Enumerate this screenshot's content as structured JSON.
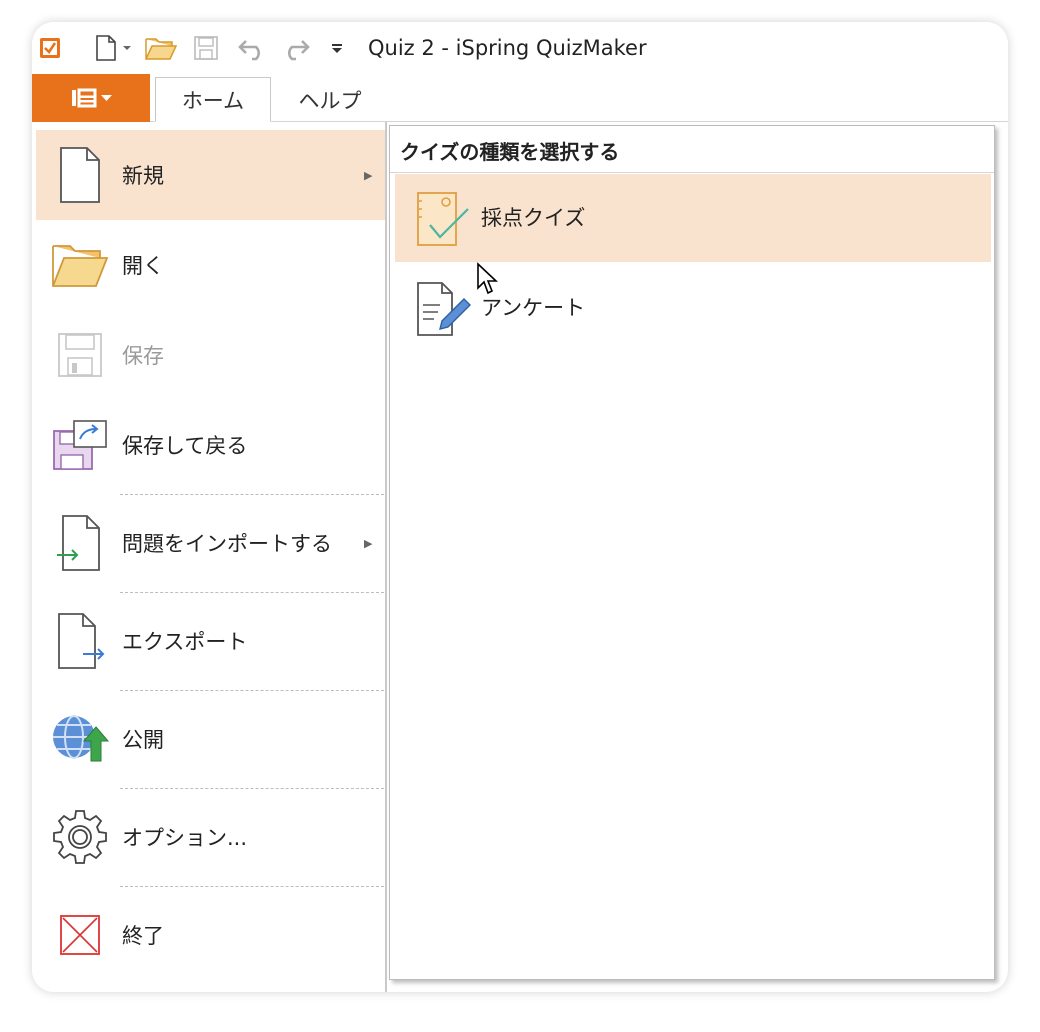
{
  "window": {
    "title": "Quiz 2 - iSpring QuizMaker"
  },
  "tabs": [
    {
      "label": "ホーム"
    },
    {
      "label": "ヘルプ"
    }
  ],
  "file_menu": {
    "items": [
      {
        "label": "新規"
      },
      {
        "label": "開く"
      },
      {
        "label": "保存"
      },
      {
        "label": "保存して戻る"
      },
      {
        "label": "問題をインポートする"
      },
      {
        "label": "エクスポート"
      },
      {
        "label": "公開"
      },
      {
        "label": "オプション..."
      },
      {
        "label": "終了"
      }
    ]
  },
  "submenu": {
    "header": "クイズの種類を選択する",
    "items": [
      {
        "label": "採点クイズ"
      },
      {
        "label": "アンケート"
      }
    ]
  },
  "colors": {
    "accent": "#e8721b",
    "selection": "#f9e3cf"
  }
}
